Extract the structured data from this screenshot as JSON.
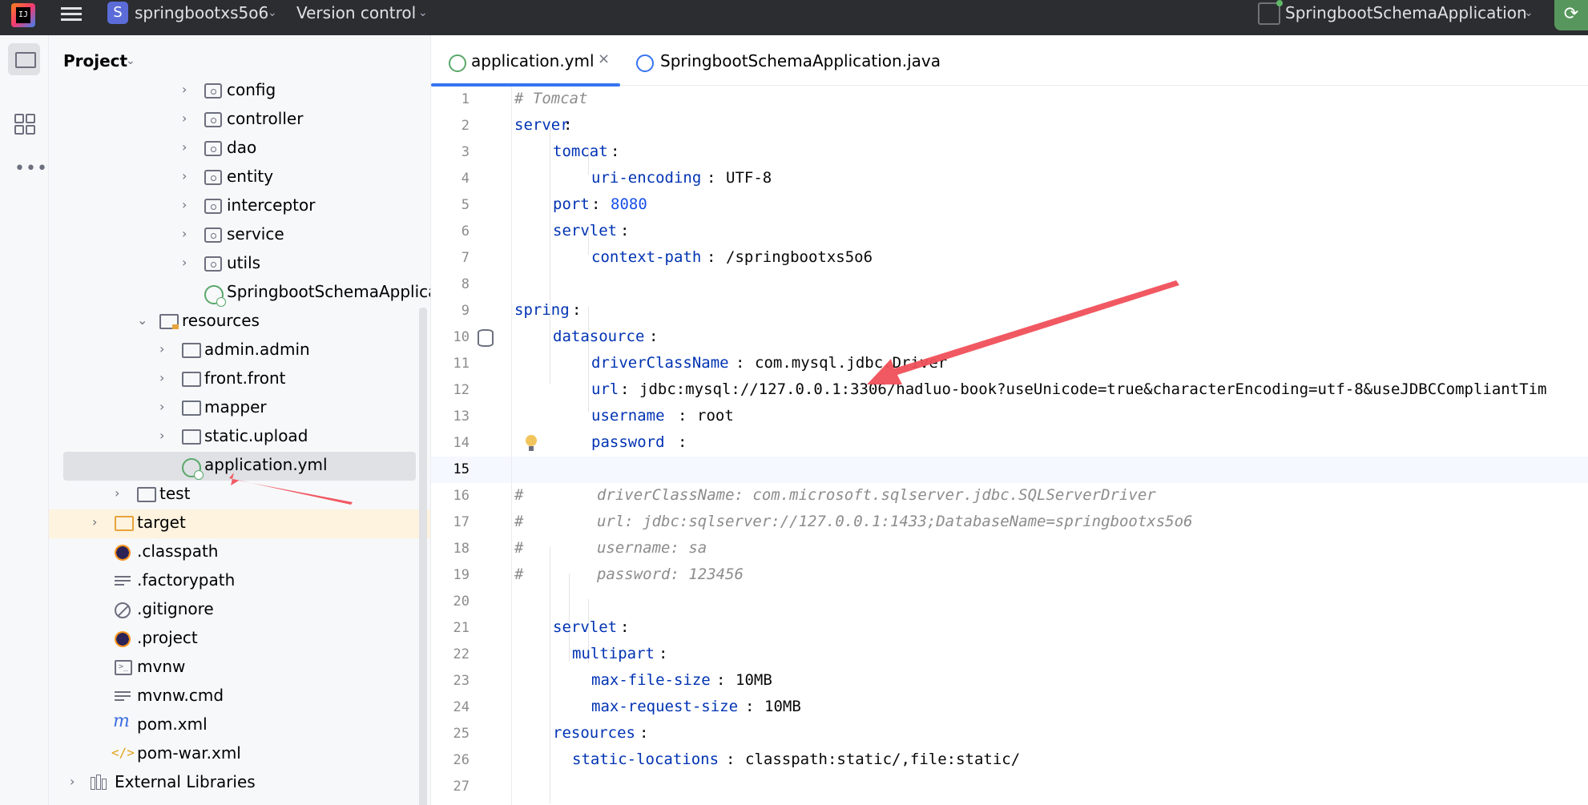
{
  "titlebar": {
    "logo_text": "IJ",
    "project_badge": "S",
    "project_name": "springbootxs5o6",
    "vcs": "Version control",
    "run_config": "SpringbootSchemaApplication",
    "caret": "⌄"
  },
  "project": {
    "title": "Project",
    "caret": "⌄",
    "tree": [
      {
        "label": "config",
        "chev": "›",
        "icon": "package-icon"
      },
      {
        "label": "controller",
        "chev": "›",
        "icon": "package-icon"
      },
      {
        "label": "dao",
        "chev": "›",
        "icon": "package-icon"
      },
      {
        "label": "entity",
        "chev": "›",
        "icon": "package-icon"
      },
      {
        "label": "interceptor",
        "chev": "›",
        "icon": "package-icon"
      },
      {
        "label": "service",
        "chev": "›",
        "icon": "package-icon"
      },
      {
        "label": "utils",
        "chev": "›",
        "icon": "package-icon"
      },
      {
        "label": "SpringbootSchemaApplicati",
        "chev": "",
        "icon": "spring-class-icon"
      },
      {
        "label": "resources",
        "chev": "⌄",
        "icon": "resources-folder-icon"
      },
      {
        "label": "admin.admin",
        "chev": "›",
        "icon": "folder-icon"
      },
      {
        "label": "front.front",
        "chev": "›",
        "icon": "folder-icon"
      },
      {
        "label": "mapper",
        "chev": "›",
        "icon": "folder-icon"
      },
      {
        "label": "static.upload",
        "chev": "›",
        "icon": "folder-icon"
      },
      {
        "label": "application.yml",
        "chev": "",
        "icon": "spring-yml-icon"
      },
      {
        "label": "test",
        "chev": "›",
        "icon": "folder-icon"
      },
      {
        "label": "target",
        "chev": "›",
        "icon": "folder-orange-icon"
      },
      {
        "label": ".classpath",
        "chev": "",
        "icon": "eclipse-icon"
      },
      {
        "label": ".factorypath",
        "chev": "",
        "icon": "text-file-icon"
      },
      {
        "label": ".gitignore",
        "chev": "",
        "icon": "ignore-file-icon"
      },
      {
        "label": ".project",
        "chev": "",
        "icon": "eclipse-icon"
      },
      {
        "label": "mvnw",
        "chev": "",
        "icon": "shell-script-icon"
      },
      {
        "label": "mvnw.cmd",
        "chev": "",
        "icon": "text-file-icon"
      },
      {
        "label": "pom.xml",
        "chev": "",
        "icon": "maven-icon"
      },
      {
        "label": "pom-war.xml",
        "chev": "",
        "icon": "xml-icon"
      },
      {
        "label": "External Libraries",
        "chev": "›",
        "icon": "library-icon"
      }
    ]
  },
  "editor": {
    "tabs": [
      {
        "label": "application.yml",
        "close": "×",
        "active": true
      },
      {
        "label": "SpringbootSchemaApplication.java",
        "active": false
      }
    ],
    "current_line": 15,
    "lines": [
      "1",
      "2",
      "3",
      "4",
      "5",
      "6",
      "7",
      "8",
      "9",
      "10",
      "11",
      "12",
      "13",
      "14",
      "15",
      "16",
      "17",
      "18",
      "19",
      "20",
      "21",
      "22",
      "23",
      "24",
      "25",
      "26",
      "27"
    ],
    "code": {
      "l1": "# Tomcat",
      "l2_key": "server",
      "l3_key": "tomcat",
      "l4_key": "uri-encoding",
      "l4_val": "UTF-8",
      "l5_key": "port",
      "l5_val": "8080",
      "l6_key": "servlet",
      "l7_key": "context-path",
      "l7_val": "/springbootxs5o6",
      "l9_key": "spring",
      "l10_key": "datasource",
      "l11_key": "driverClassName",
      "l11_val": "com.mysql.jdbc.Driver",
      "l12_key": "url",
      "l12_val": "jdbc:mysql://127.0.0.1:3306/hadluo-book?useUnicode=true&characterEncoding=utf-8&useJDBCCompliantTim",
      "l13_key": "username",
      "l13_val": "root",
      "l14_key": "password",
      "l16": "#        driverClassName: com.microsoft.sqlserver.jdbc.SQLServerDriver",
      "l17": "#        url: jdbc:sqlserver://127.0.0.1:1433;DatabaseName=springbootxs5o6",
      "l18": "#        username: sa",
      "l19": "#        password: 123456",
      "l21_key": "servlet",
      "l22_key": "multipart",
      "l23_key": "max-file-size",
      "l23_val": "10MB",
      "l24_key": "max-request-size",
      "l24_val": "10MB",
      "l25_key": "resources",
      "l26_key": "static-locations",
      "l26_val": "classpath:static/,file:static/"
    }
  },
  "colors": {
    "accent": "#3574f0",
    "annotation_arrow": "#f0505a",
    "yaml_key": "#0033b3",
    "number": "#1750eb",
    "comment": "#8c8c8c"
  }
}
